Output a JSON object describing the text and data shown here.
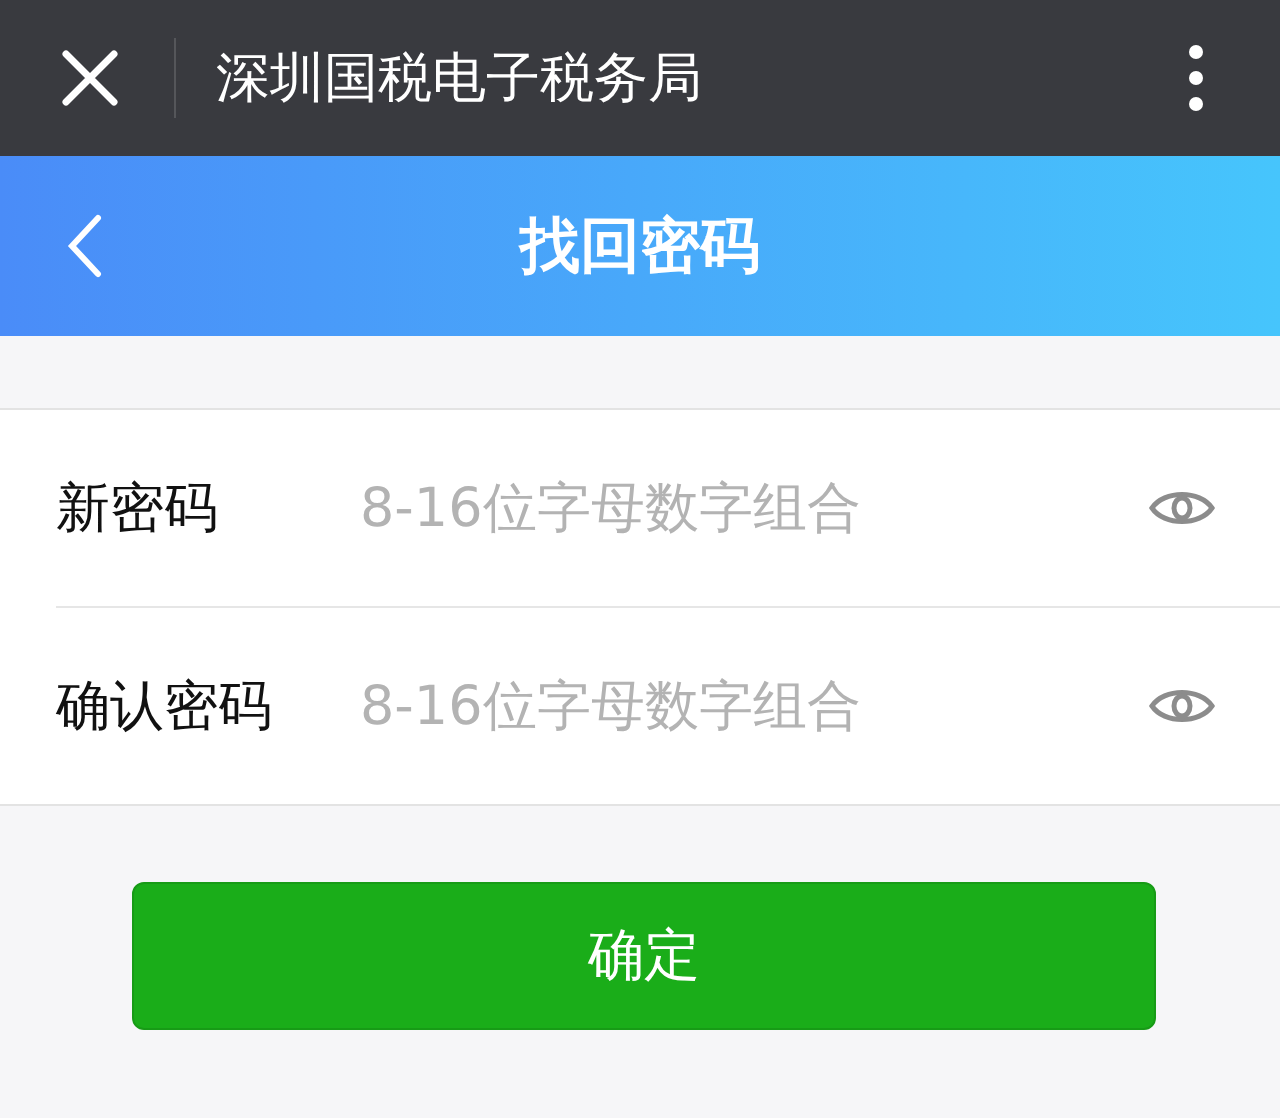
{
  "app_bar": {
    "title": "深圳国税电子税务局"
  },
  "header": {
    "title": "找回密码"
  },
  "fields": [
    {
      "label": "新密码",
      "placeholder": "8-16位字母数字组合"
    },
    {
      "label": "确认密码",
      "placeholder": "8-16位字母数字组合"
    }
  ],
  "submit": {
    "label": "确定"
  }
}
